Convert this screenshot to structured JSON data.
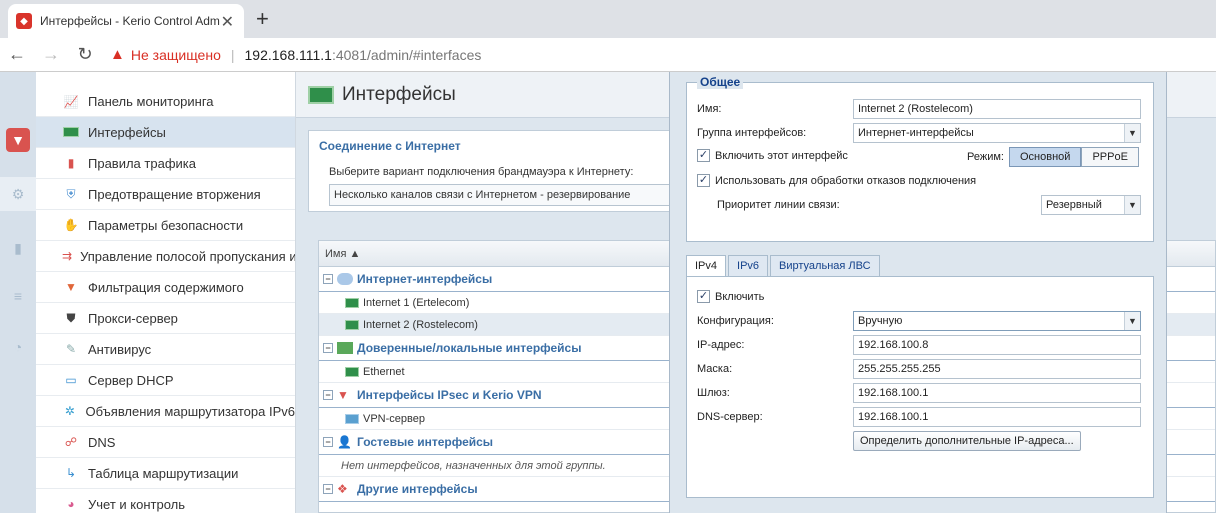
{
  "browser": {
    "tab_title": "Интерфейсы - Kerio Control Adminis",
    "not_secure": "Не защищено",
    "url_host": "192.168.111.1",
    "url_rest": ":4081/admin/#interfaces"
  },
  "sidebar": {
    "items": [
      {
        "label": "Панель мониторинга",
        "icon": "chart-icon"
      },
      {
        "label": "Интерфейсы",
        "icon": "network-card-icon"
      },
      {
        "label": "Правила трафика",
        "icon": "traffic-light-icon"
      },
      {
        "label": "Предотвращение вторжения",
        "icon": "shield-icon"
      },
      {
        "label": "Параметры безопасности",
        "icon": "hand-icon"
      },
      {
        "label": "Управление полосой пропускания и",
        "icon": "bandwidth-icon"
      },
      {
        "label": "Фильтрация содержимого",
        "icon": "filter-icon"
      },
      {
        "label": "Прокси-сервер",
        "icon": "proxy-icon"
      },
      {
        "label": "Антивирус",
        "icon": "syringe-icon"
      },
      {
        "label": "Сервер DHCP",
        "icon": "monitor-icon"
      },
      {
        "label": "Объявления маршрутизатора IPv6",
        "icon": "router-icon"
      },
      {
        "label": "DNS",
        "icon": "dns-icon"
      },
      {
        "label": "Таблица маршрутизации",
        "icon": "routing-icon"
      },
      {
        "label": "Учет и контроль",
        "icon": "pie-icon"
      }
    ]
  },
  "main": {
    "title": "Интерфейсы",
    "inet": {
      "legend": "Соединение с Интернет",
      "description": "Выберите вариант подключения брандмауэра к Интернету:",
      "mode": "Несколько каналов связи с Интернетом - резервирование"
    },
    "grid": {
      "col_name": "Имя ▲",
      "groups": [
        {
          "label": "Интернет-интерфейсы",
          "rows": [
            "Internet 1 (Ertelecom)",
            "Internet 2 (Rostelecom)"
          ]
        },
        {
          "label": "Доверенные/локальные интерфейсы",
          "rows": [
            "Ethernet"
          ]
        },
        {
          "label": "Интерфейсы IPsec и Kerio VPN",
          "rows": [
            "VPN-сервер"
          ]
        },
        {
          "label": "Гостевые интерфейсы",
          "empty": "Нет интерфейсов, назначенных для этой группы."
        },
        {
          "label": "Другие интерфейсы",
          "rows": []
        }
      ]
    }
  },
  "dialog": {
    "general_legend": "Общее",
    "name_label": "Имя:",
    "name_value": "Internet 2 (Rostelecom)",
    "group_label": "Группа интерфейсов:",
    "group_value": "Интернет-интерфейсы",
    "enable_iface": "Включить этот интерфейс",
    "mode_label": "Режим:",
    "mode_options": [
      "Основной",
      "PPPoE"
    ],
    "failover": "Использовать для обработки отказов подключения",
    "priority_label": "Приоритет линии связи:",
    "priority_value": "Резервный",
    "tabs": [
      "IPv4",
      "IPv6",
      "Виртуальная ЛВС"
    ],
    "ipv4": {
      "enable": "Включить",
      "config_label": "Конфигурация:",
      "config_value": "Вручную",
      "ip_label": "IP-адрес:",
      "ip_value": "192.168.100.8",
      "mask_label": "Маска:",
      "mask_value": "255.255.255.255",
      "gw_label": "Шлюз:",
      "gw_value": "192.168.100.1",
      "dns_label": "DNS-сервер:",
      "dns_value": "192.168.100.1",
      "extra_ips_button": "Определить дополнительные IP-адреса..."
    }
  }
}
